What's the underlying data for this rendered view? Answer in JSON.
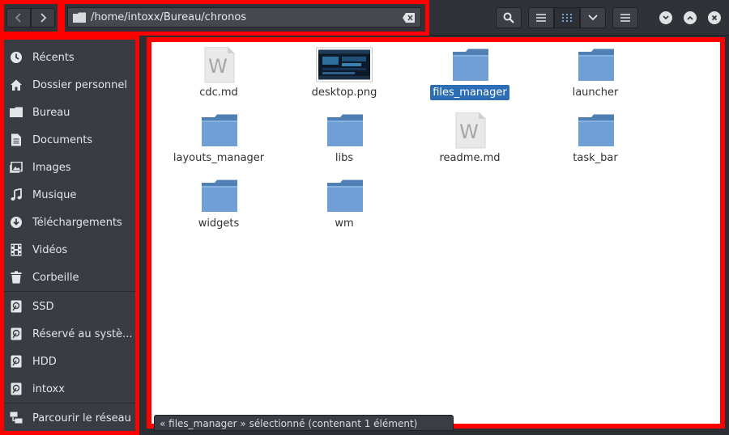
{
  "header": {
    "path_value": "/home/intoxx/Bureau/chronos"
  },
  "sidebar": {
    "places": [
      {
        "label": "Récents",
        "icon": "clock-icon"
      },
      {
        "label": "Dossier personnel",
        "icon": "home-icon"
      },
      {
        "label": "Bureau",
        "icon": "folder-icon"
      },
      {
        "label": "Documents",
        "icon": "document-icon"
      },
      {
        "label": "Images",
        "icon": "image-icon"
      },
      {
        "label": "Musique",
        "icon": "music-icon"
      },
      {
        "label": "Téléchargements",
        "icon": "download-icon"
      },
      {
        "label": "Vidéos",
        "icon": "film-icon"
      },
      {
        "label": "Corbeille",
        "icon": "trash-icon"
      }
    ],
    "devices": [
      {
        "label": "SSD",
        "icon": "drive-icon"
      },
      {
        "label": "Réservé au systè...",
        "icon": "drive-icon"
      },
      {
        "label": "HDD",
        "icon": "drive-icon"
      },
      {
        "label": "intoxx",
        "icon": "drive-icon"
      }
    ],
    "network": [
      {
        "label": "Parcourir le réseau",
        "icon": "network-icon"
      }
    ]
  },
  "files": [
    {
      "name": "cdc.md",
      "kind": "text"
    },
    {
      "name": "desktop.png",
      "kind": "image"
    },
    {
      "name": "files_manager",
      "kind": "folder",
      "selected": true
    },
    {
      "name": "launcher",
      "kind": "folder"
    },
    {
      "name": "layouts_manager",
      "kind": "folder"
    },
    {
      "name": "libs",
      "kind": "folder"
    },
    {
      "name": "readme.md",
      "kind": "text"
    },
    {
      "name": "task_bar",
      "kind": "folder"
    },
    {
      "name": "widgets",
      "kind": "folder"
    },
    {
      "name": "wm",
      "kind": "folder"
    }
  ],
  "status": {
    "text": "« files_manager » sélectionné  (contenant 1 élément)"
  },
  "colors": {
    "selection": "#2c6db5",
    "folder": "#6f9fd4",
    "highlight_frame": "#ff0000"
  }
}
